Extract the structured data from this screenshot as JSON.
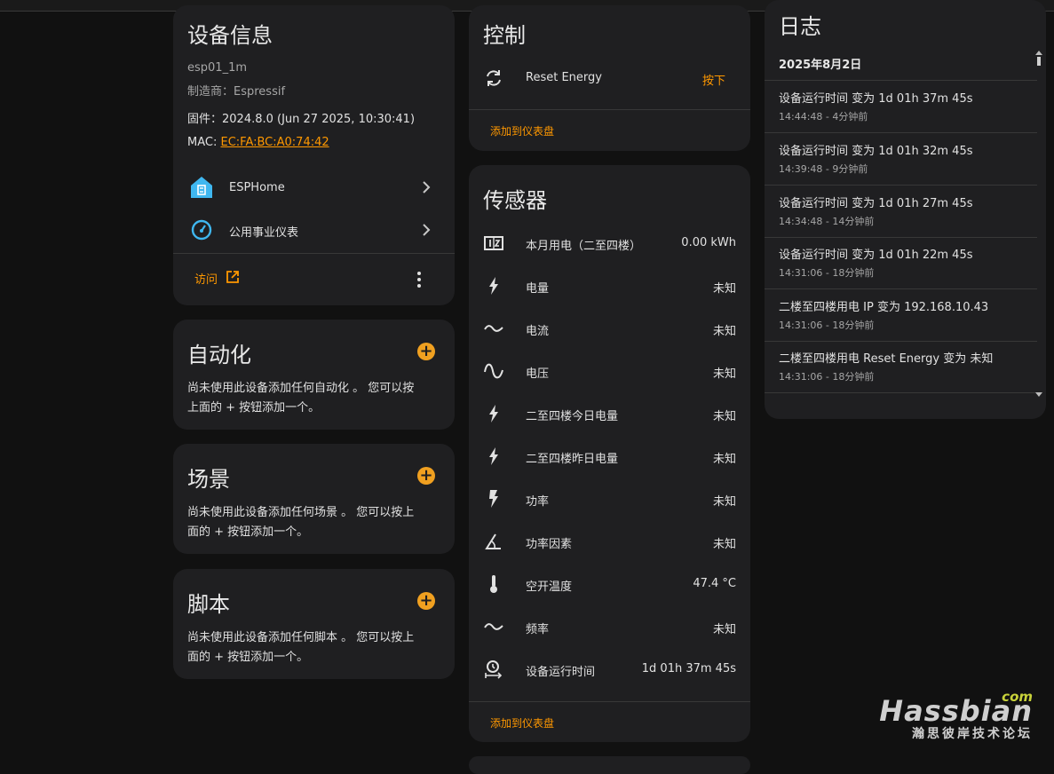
{
  "device_info": {
    "title": "设备信息",
    "model": "esp01_1m",
    "manufacturer": "制造商：Espressif",
    "firmware": "固件：2024.8.0 (Jun 27 2025, 10:30:41)",
    "mac_label": "MAC: ",
    "mac_value": "EC:FA:BC:A0:74:42",
    "integrations": [
      {
        "label": "ESPHome",
        "icon": "esphome-icon"
      },
      {
        "label": "公用事业仪表",
        "icon": "utility-meter-icon"
      }
    ],
    "visit_label": "访问"
  },
  "automation": {
    "title": "自动化",
    "desc_line1": "尚未使用此设备添加任何自动化 。 您可以按",
    "desc_line2": "上面的 + 按钮添加一个。"
  },
  "scene": {
    "title": "场景",
    "desc_line1": "尚未使用此设备添加任何场景 。 您可以按上",
    "desc_line2": "面的 + 按钮添加一个。"
  },
  "script": {
    "title": "脚本",
    "desc_line1": "尚未使用此设备添加任何脚本 。 您可以按上",
    "desc_line2": "面的 + 按钮添加一个。"
  },
  "controls": {
    "title": "控制",
    "items": [
      {
        "name": "Reset Energy",
        "action": "按下",
        "icon": "restart-icon"
      }
    ],
    "add_dashboard": "添加到仪表盘"
  },
  "sensors": {
    "title": "传感器",
    "items": [
      {
        "name": "本月用电（二至四楼）",
        "value": "0.00 kWh",
        "icon": "counter-icon"
      },
      {
        "name": "电量",
        "value": "未知",
        "icon": "lightning-icon"
      },
      {
        "name": "电流",
        "value": "未知",
        "icon": "current-ac-icon"
      },
      {
        "name": "电压",
        "value": "未知",
        "icon": "sine-wave-icon"
      },
      {
        "name": "二至四楼今日电量",
        "value": "未知",
        "icon": "lightning-icon"
      },
      {
        "name": "二至四楼昨日电量",
        "value": "未知",
        "icon": "lightning-icon"
      },
      {
        "name": "功率",
        "value": "未知",
        "icon": "flash-icon"
      },
      {
        "name": "功率因素",
        "value": "未知",
        "icon": "angle-icon"
      },
      {
        "name": "空开温度",
        "value": "47.4 °C",
        "icon": "thermometer-icon"
      },
      {
        "name": "频率",
        "value": "未知",
        "icon": "current-ac-icon"
      },
      {
        "name": "设备运行时间",
        "value": "1d 01h 37m 45s",
        "icon": "timer-icon"
      }
    ],
    "add_dashboard": "添加到仪表盘"
  },
  "logbook": {
    "title": "日志",
    "date": "2025年8月2日",
    "entries": [
      {
        "message": "设备运行时间 变为 1d 01h 37m 45s",
        "time": "14:44:48 - 4分钟前"
      },
      {
        "message": "设备运行时间 变为 1d 01h 32m 45s",
        "time": "14:39:48 - 9分钟前"
      },
      {
        "message": "设备运行时间 变为 1d 01h 27m 45s",
        "time": "14:34:48 - 14分钟前"
      },
      {
        "message": "设备运行时间 变为 1d 01h 22m 45s",
        "time": "14:31:06 - 18分钟前"
      },
      {
        "message": "二楼至四楼用电 IP 变为 192.168.10.43",
        "time": "14:31:06 - 18分钟前"
      },
      {
        "message": "二楼至四楼用电 Reset Energy 变为 未知",
        "time": "14:31:06 - 18分钟前"
      }
    ]
  },
  "watermark": {
    "brand": "Hassbian",
    "com": "com",
    "subtitle": "瀚思彼岸技术论坛"
  },
  "colors": {
    "accent": "#ff9800",
    "card": "#1f1f21",
    "background": "#111111"
  }
}
